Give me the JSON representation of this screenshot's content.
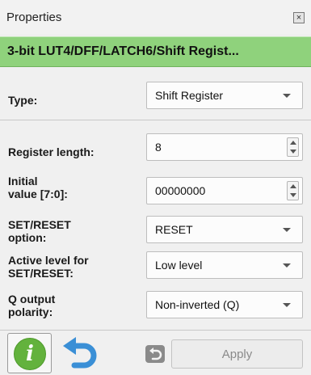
{
  "window": {
    "title": "Properties",
    "close_glyph": "×"
  },
  "block": {
    "title": "3-bit LUT4/DFF/LATCH6/Shift Regist..."
  },
  "type": {
    "label": "Type:",
    "value": "Shift Register"
  },
  "register_length": {
    "label": "Register length:",
    "value": "8"
  },
  "initial_value": {
    "label_line1": "Initial",
    "label_line2": "value [7:0]:",
    "value": "00000000"
  },
  "set_reset_option": {
    "label_line1": "SET/RESET",
    "label_line2": "option:",
    "value": "RESET"
  },
  "active_level": {
    "label_line1": "Active level for",
    "label_line2": "SET/RESET:",
    "value": "Low level"
  },
  "q_output_polarity": {
    "label_line1": "Q output",
    "label_line2": "polarity:",
    "value": "Non-inverted (Q)"
  },
  "footer": {
    "info_glyph": "i",
    "apply_label": "Apply"
  },
  "colors": {
    "header_green": "#8fd27c",
    "info_green": "#63b23d",
    "undo_blue": "#3a8fd6"
  }
}
